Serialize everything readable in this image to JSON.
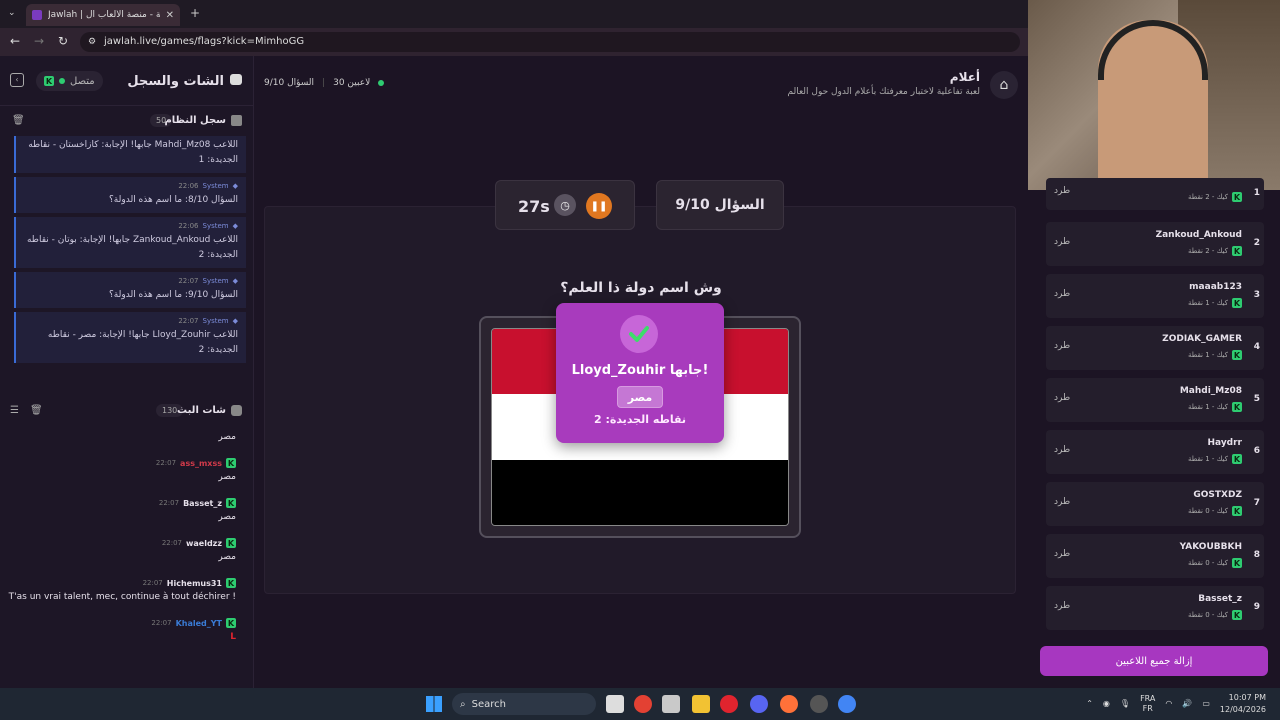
{
  "browser": {
    "tab_title": "Jawlah | جولة - منصة الألعاب ال...",
    "url": "jawlah.live/games/flags?kick=MimhoGG",
    "new_tab": "+"
  },
  "left_panel": {
    "title": "الشات والسجل",
    "status": "متصل",
    "system_log_title": "سجل النظام",
    "system_log_count": "50",
    "logs": [
      {
        "sender": "",
        "time": "",
        "text": "اللاعب Mahdi_Mz08 جابها! الإجابة: كازاخستان - نقاطه الجديدة: 1"
      },
      {
        "sender": "System",
        "time": "22:06",
        "text": "السؤال 8/10: ما اسم هذه الدولة؟"
      },
      {
        "sender": "System",
        "time": "22:06",
        "text": "اللاعب Zankoud_Ankoud جابها! الإجابة: بوتان - نقاطه الجديدة: 2"
      },
      {
        "sender": "System",
        "time": "22:07",
        "text": "السؤال 9/10: ما اسم هذه الدولة؟"
      },
      {
        "sender": "System",
        "time": "22:07",
        "text": "اللاعب Lloyd_Zouhir جابها! الإجابة: مصر - نقاطه الجديدة: 2"
      }
    ],
    "chat_title": "شات البث",
    "chat_count": "130",
    "chat": [
      {
        "user": "",
        "time": "",
        "text": "مصر",
        "color": "#e6e0ea"
      },
      {
        "user": "ass_mxss",
        "time": "22:07",
        "text": "مصر",
        "color": "#d23a4a"
      },
      {
        "user": "Basset_z",
        "time": "22:07",
        "text": "مصر",
        "color": "#e6e0ea"
      },
      {
        "user": "waeldzz",
        "time": "22:07",
        "text": "مصر",
        "color": "#e6e0ea"
      },
      {
        "user": "Hichemus31",
        "time": "22:07",
        "text": "T'as un vrai talent, mec, continue à tout déchirer !",
        "color": "#e6e0ea"
      },
      {
        "user": "Khaled_YT",
        "time": "22:07",
        "text": "L",
        "color": "#3a7bd5"
      }
    ]
  },
  "center": {
    "game_title": "أعلام",
    "game_subtitle": "لعبة تفاعلية لاختبار معرفتك بأعلام الدول حول العالم",
    "players_online": "30 لاعبين",
    "question_counter_small": "السؤال 9/10",
    "timer": "27s",
    "question_card": "السؤال 9/10",
    "question": "وش اسم دولة ذا العلم؟",
    "popup_title": "Lloyd_Zouhir جابها!",
    "popup_answer": "مصر",
    "popup_points": "نقاطه الجديدة: 2",
    "flag_colors": [
      "#c8102e",
      "#ffffff",
      "#000000"
    ]
  },
  "right_panel": {
    "kick_label": "طرد",
    "remove_all": "إزالة جميع اللاعبين",
    "players": [
      {
        "rank": "1",
        "name": "",
        "sub": "كيك - 2 نقطة"
      },
      {
        "rank": "2",
        "name": "Zankoud_Ankoud",
        "sub": "كيك - 2 نقطة"
      },
      {
        "rank": "3",
        "name": "maaab123",
        "sub": "كيك - 1 نقطة"
      },
      {
        "rank": "4",
        "name": "ZODIAK_GAMER",
        "sub": "كيك - 1 نقطة"
      },
      {
        "rank": "5",
        "name": "Mahdi_Mz08",
        "sub": "كيك - 1 نقطة"
      },
      {
        "rank": "6",
        "name": "Haydrr",
        "sub": "كيك - 1 نقطة"
      },
      {
        "rank": "7",
        "name": "GOSTXDZ",
        "sub": "كيك - 0 نقطة"
      },
      {
        "rank": "8",
        "name": "YAKOUBBKH",
        "sub": "كيك - 0 نقطة"
      },
      {
        "rank": "9",
        "name": "Basset_z",
        "sub": "كيك - 0 نقطة"
      }
    ]
  },
  "taskbar": {
    "search": "Search",
    "lang_top": "FRA",
    "lang_bottom": "FR",
    "time": "10:07 PM",
    "date": "12/04/2026"
  }
}
